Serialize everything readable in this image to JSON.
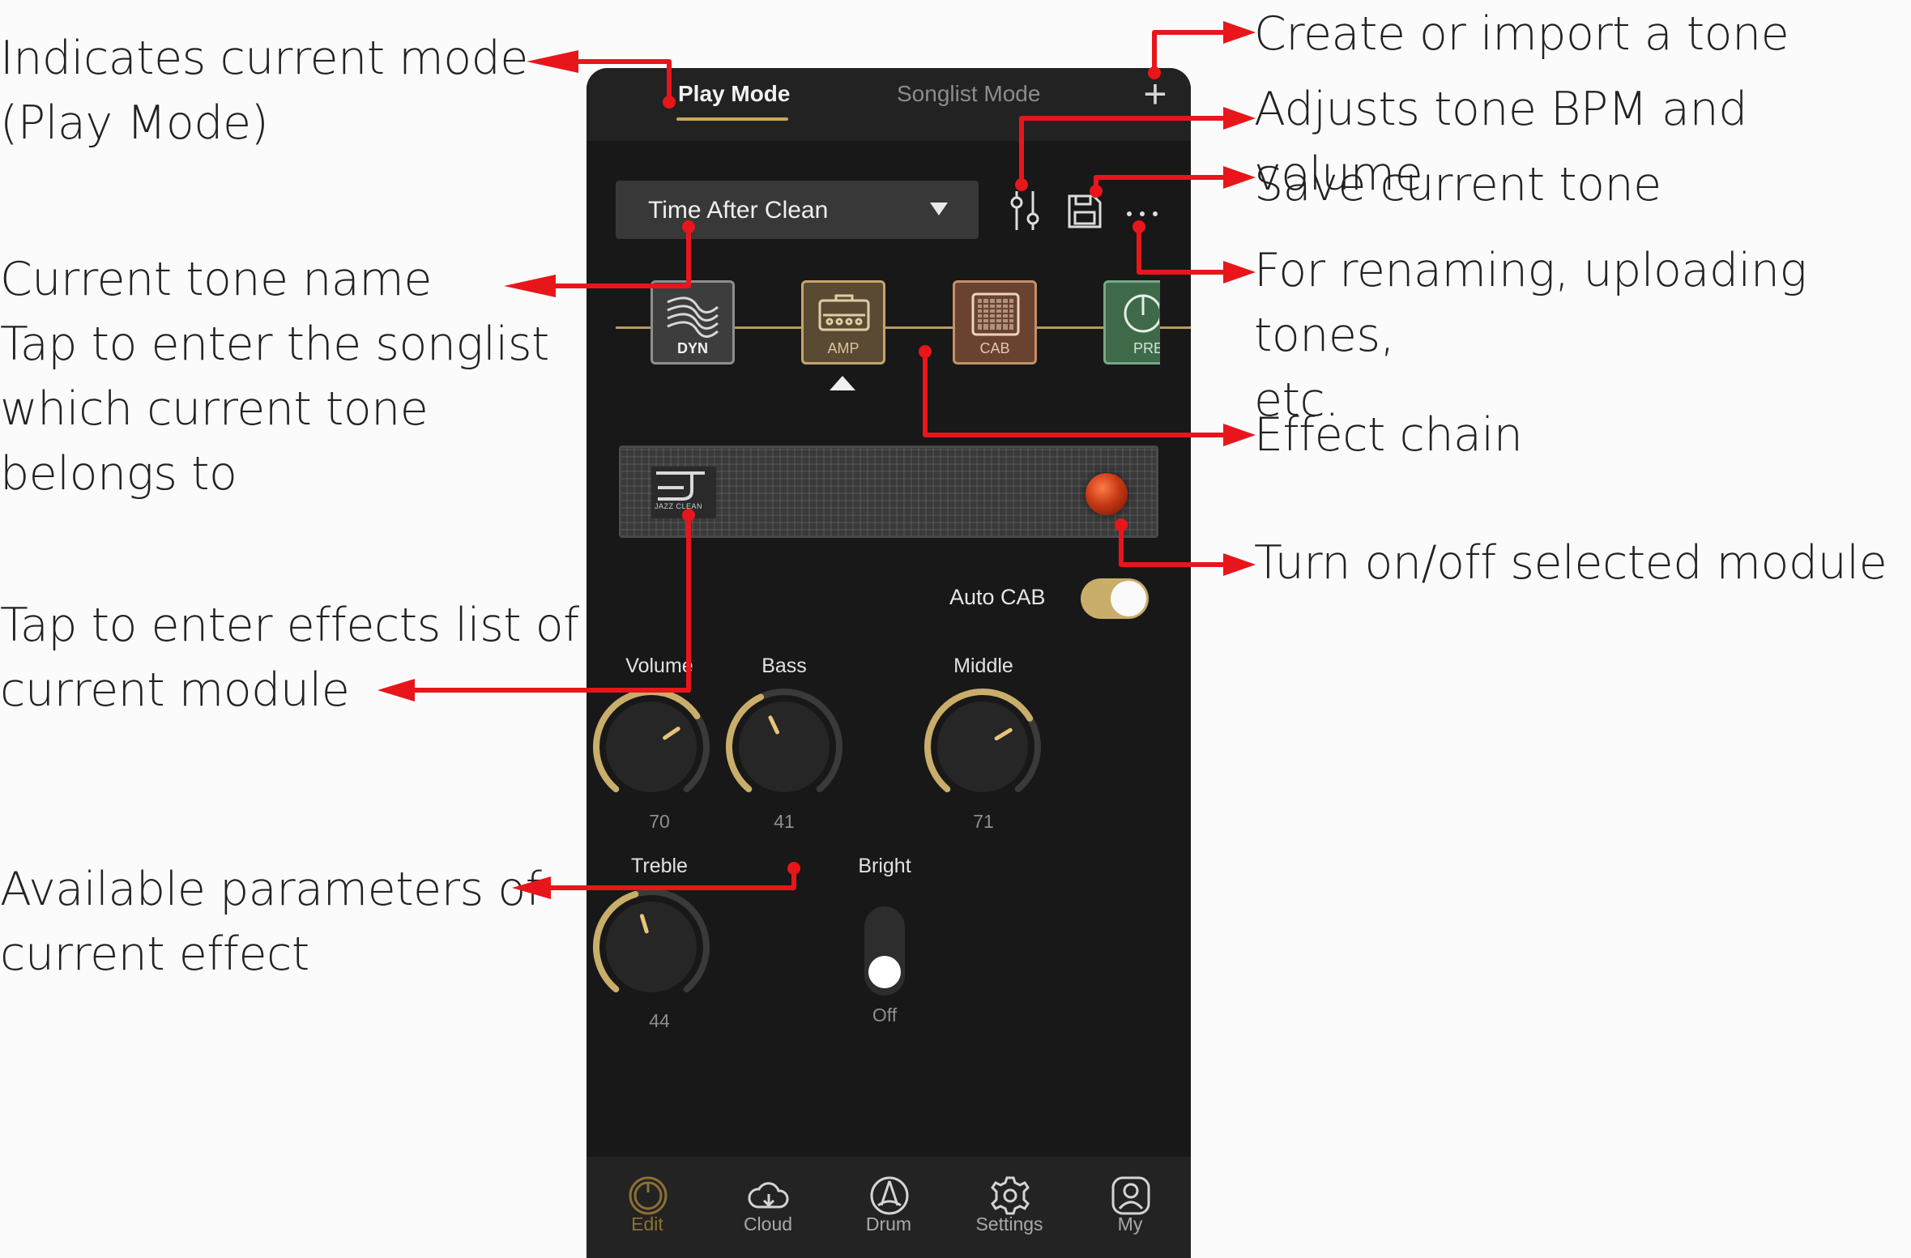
{
  "annotations": {
    "mode_indicator": "Indicates current mode\n(Play Mode)",
    "tone_name": "Current tone name\nTap to enter the songlist\nwhich current tone\nbelongs to",
    "effects_list": "Tap to enter effects list of\ncurrent module",
    "parameters": "Available parameters of\ncurrent effect",
    "create_tone": "Create or import a tone",
    "bpm_volume": "Adjusts tone BPM and volume",
    "save_tone": "Save current tone",
    "more_options": "For renaming, uploading tones,\netc.",
    "effect_chain": "Effect chain",
    "module_power": "Turn on/off selected module"
  },
  "colors": {
    "annotation_arrow": "#e8161b",
    "accent_gold": "#c9ad6a",
    "background": "#181818"
  },
  "app": {
    "tabs": [
      {
        "label": "Play Mode",
        "active": true
      },
      {
        "label": "Songlist Mode",
        "active": false
      }
    ],
    "add_icon": "plus-icon",
    "tone_name": "Time After Clean",
    "toolbar_icons": [
      "sliders-icon",
      "save-icon",
      "more-icon"
    ],
    "chain": {
      "modules": [
        {
          "label": "DYN",
          "icon": "dyn-waves-icon"
        },
        {
          "label": "AMP",
          "icon": "amp-icon",
          "selected": true
        },
        {
          "label": "CAB",
          "icon": "cab-grille-icon"
        },
        {
          "label": "PRE",
          "icon": "pre-pedal-icon"
        }
      ]
    },
    "amp_panel": {
      "logo_text": "JAZZ CLEAN",
      "power_on": true
    },
    "auto_cab": {
      "label": "Auto CAB",
      "on": true
    },
    "params": [
      {
        "label": "Volume",
        "value": "70"
      },
      {
        "label": "Bass",
        "value": "41"
      },
      {
        "label": "Middle",
        "value": "71"
      },
      {
        "label": "Treble",
        "value": "44"
      }
    ],
    "bright": {
      "label": "Bright",
      "state": "Off"
    },
    "nav": [
      {
        "label": "Edit",
        "icon": "edit-knob-icon",
        "active": true
      },
      {
        "label": "Cloud",
        "icon": "cloud-icon"
      },
      {
        "label": "Drum",
        "icon": "drum-icon"
      },
      {
        "label": "Settings",
        "icon": "settings-gear-icon"
      },
      {
        "label": "My",
        "icon": "user-icon"
      }
    ]
  }
}
